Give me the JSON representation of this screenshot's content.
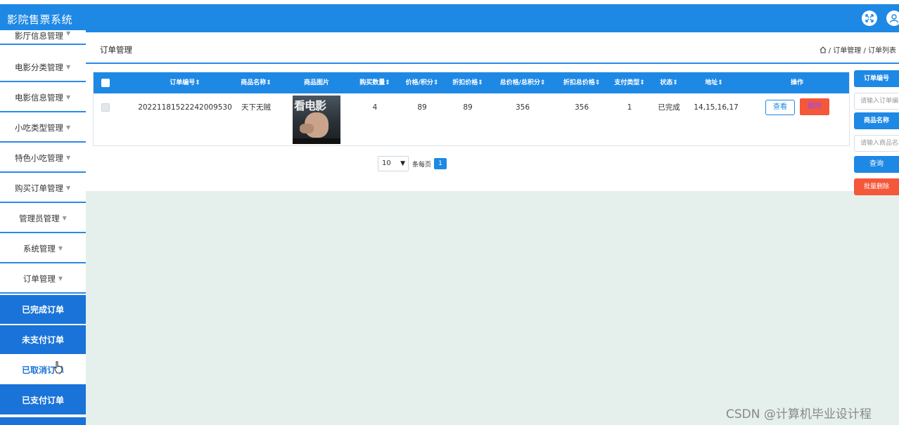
{
  "header": {
    "app_title": "影院售票系统"
  },
  "sidebar": {
    "items": [
      {
        "label": "影厅信息管理"
      },
      {
        "label": "电影分类管理"
      },
      {
        "label": "电影信息管理"
      },
      {
        "label": "小吃类型管理"
      },
      {
        "label": "特色小吃管理"
      },
      {
        "label": "购买订单管理"
      },
      {
        "label": "管理员管理"
      },
      {
        "label": "系统管理"
      },
      {
        "label": "订单管理"
      }
    ],
    "submenu": [
      {
        "label": "已完成订单"
      },
      {
        "label": "未支付订单"
      },
      {
        "label": "已取消订单"
      },
      {
        "label": "已支付订单"
      }
    ]
  },
  "content": {
    "page_title": "订单管理",
    "breadcrumb": "/ 订单管理 / 订单列表"
  },
  "table": {
    "columns": [
      "订单编号",
      "商品名称",
      "商品图片",
      "购买数量",
      "价格/积分",
      "折扣价格",
      "总价格/总积分",
      "折扣总价格",
      "支付类型",
      "状态",
      "地址",
      "操作"
    ],
    "sort_mark": "⇕",
    "rows": [
      {
        "order_no": "20221181522242009530",
        "product_name": "天下无贼",
        "poster_text": "看电影",
        "quantity": "4",
        "price": "89",
        "discount_price": "89",
        "total_price": "356",
        "discount_total": "356",
        "pay_type": "1",
        "status": "已完成",
        "address": "14,15,16,17",
        "view_label": "查看",
        "delete_label": "删除"
      }
    ]
  },
  "pagination": {
    "page_size": "10",
    "per_page_label": "条每页",
    "current_page": "1"
  },
  "search": {
    "order_no_label": "订单编号",
    "order_no_placeholder": "请输入订单编号",
    "product_label": "商品名称",
    "product_placeholder": "请输入商品名称",
    "query_label": "查询",
    "batch_delete_label": "批量删除"
  },
  "watermark": "CSDN @计算机毕业设计程",
  "colors": {
    "primary": "#1e88e5",
    "danger": "#f4573a",
    "main_bg": "#e5efec"
  }
}
